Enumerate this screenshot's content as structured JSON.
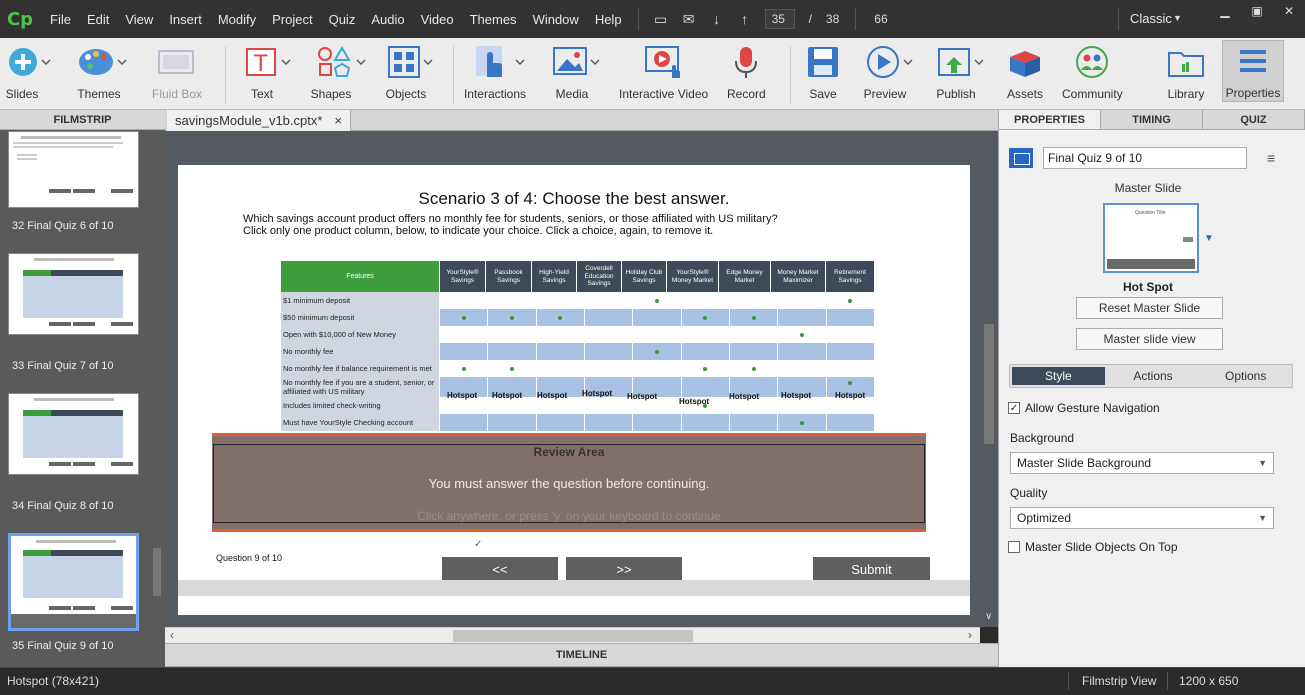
{
  "menubar": {
    "logo": "Cp",
    "items": [
      "File",
      "Edit",
      "View",
      "Insert",
      "Modify",
      "Project",
      "Quiz",
      "Audio",
      "Video",
      "Themes",
      "Window",
      "Help"
    ],
    "slide_current": "35",
    "slide_separator": "/",
    "slide_total": "38",
    "zoom": "66",
    "workspace": "Classic"
  },
  "toolbar": {
    "slides": "Slides",
    "themes": "Themes",
    "fluid_box": "Fluid Box",
    "text": "Text",
    "shapes": "Shapes",
    "objects": "Objects",
    "interactions": "Interactions",
    "media": "Media",
    "interactive_video": "Interactive Video",
    "record": "Record",
    "save": "Save",
    "preview": "Preview",
    "publish": "Publish",
    "assets": "Assets",
    "community": "Community",
    "library": "Library",
    "properties": "Properties"
  },
  "filmstrip": {
    "header": "FILMSTRIP",
    "slides": [
      {
        "caption": "32 Final Quiz 6 of 10"
      },
      {
        "caption": "33 Final Quiz 7 of 10"
      },
      {
        "caption": "34 Final Quiz 8 of 10"
      },
      {
        "caption": "35 Final Quiz 9 of 10"
      }
    ]
  },
  "document": {
    "tab_name": "savingsModule_v1b.cptx*",
    "tab_close": "×"
  },
  "slide": {
    "title": "Scenario 3 of 4: Choose the best answer.",
    "question_line1": "Which savings account product offers no monthly fee for students, seniors, or those affiliated with US military?",
    "question_line2": "Click only one product column, below, to indicate your choice. Click a choice, again, to remove it.",
    "features_header": "Features",
    "columns": [
      "YourStyle® Savings",
      "Passbook Savings",
      "High-Yield Savings",
      "Coverdell Education Savings",
      "Holiday Club Savings",
      "YourStyle® Money Market",
      "Edge Money Market",
      "Money Market Maximizer",
      "Retirement Savings"
    ],
    "rows": [
      "$1 minimum deposit",
      "$50 minimum deposit",
      "Open with $10,000 of New Money",
      "No monthly fee",
      "No monthly fee if balance requirement is met",
      "No monthly fee if you are a student, senior, or affiliated with US military",
      "Includes limited check-writing",
      "Must have YourStyle Checking account"
    ],
    "hotspot_label": "Hotspot",
    "review_title": "Review Area",
    "review_message": "You must answer the question before continuing.",
    "review_ghost": "Click anywhere, or press 'y' on your keyboard to continue",
    "question_number": "Question 9 of 10",
    "prev_label": "<<",
    "next_label": ">>",
    "submit_label": "Submit",
    "check": "✓"
  },
  "timeline": {
    "label": "TIMELINE"
  },
  "properties": {
    "tabs": [
      "PROPERTIES",
      "TIMING",
      "QUIZ"
    ],
    "slide_name": "Final Quiz 9 of 10",
    "master_label": "Master Slide",
    "master_thumb_title": "Question Title",
    "master_name": "Hot Spot",
    "reset_master": "Reset Master Slide",
    "master_view": "Master slide view",
    "sub_tabs": [
      "Style",
      "Actions",
      "Options"
    ],
    "allow_gesture": "Allow Gesture Navigation",
    "background_label": "Background",
    "background_value": "Master Slide Background",
    "quality_label": "Quality",
    "quality_value": "Optimized",
    "master_objects_on_top": "Master Slide Objects On Top"
  },
  "statusbar": {
    "selection": "Hotspot (78x421)",
    "view": "Filmstrip View",
    "resolution": "1200 x 650"
  },
  "colors": {
    "accent": "#2766c6",
    "table_header": "#3e4a5a",
    "features_header": "#3e9e3e",
    "review_border": "#e06030"
  }
}
